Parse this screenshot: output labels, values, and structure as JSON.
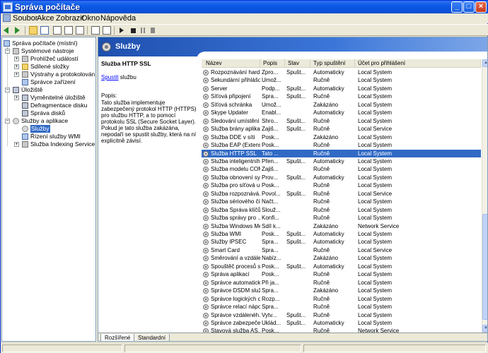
{
  "window": {
    "title": "Správa počítače"
  },
  "menu": [
    {
      "label": "Soubor"
    },
    {
      "label": "Akce"
    },
    {
      "label": "Zobrazit"
    },
    {
      "label": "Okno"
    },
    {
      "label": "Nápověda"
    }
  ],
  "tree": {
    "root": "Správa počítače (místní)",
    "items": [
      {
        "label": "Systémové nástroje"
      },
      {
        "label": "Prohlížeč událostí"
      },
      {
        "label": "Sdílené složky"
      },
      {
        "label": "Výstrahy a protokolování výk"
      },
      {
        "label": "Správce zařízení"
      },
      {
        "label": "Úložiště"
      },
      {
        "label": "Vyměnitelné úložiště"
      },
      {
        "label": "Defragmentace disku"
      },
      {
        "label": "Správa disků"
      },
      {
        "label": "Služby a aplikace"
      },
      {
        "label": "Služby"
      },
      {
        "label": "Řízení služby WMI"
      },
      {
        "label": "Služba Indexing Service"
      }
    ]
  },
  "panel": {
    "title": "Služby"
  },
  "description": {
    "service_name": "Služba HTTP SSL",
    "start_link": "Spustit",
    "start_suffix": " službu",
    "desc_label": "Popis:",
    "desc_text": "Tato služba implementuje zabezpečený protokol HTTP (HTTPS) pro službu HTTP, a to pomocí protokolu SSL (Secure Socket Layer). Pokud je tato služba zakázána, nepodaří se spustit služby, která na ní explicitně závisí."
  },
  "columns": [
    "Název",
    "Popis",
    "Stav",
    "Typ spuštění",
    "Účet pro přihlášení"
  ],
  "rows": [
    [
      "Rozpoznávání hard...",
      "Zpro...",
      "Spušt...",
      "Automaticky",
      "Local System"
    ],
    [
      "Sekundární přihlášo...",
      "Umož...",
      "",
      "Ručně",
      "Local System"
    ],
    [
      "Server",
      "Podp...",
      "Spušt...",
      "Automaticky",
      "Local System"
    ],
    [
      "Síťová připojení",
      "Spra...",
      "Spušt...",
      "Ručně",
      "Local System"
    ],
    [
      "Síťová schránka",
      "Umož...",
      "",
      "Zakázáno",
      "Local System"
    ],
    [
      "Skype Updater",
      "Enabl...",
      "",
      "Automaticky",
      "Local System"
    ],
    [
      "Sledování umístění ...",
      "Shro...",
      "Spušt...",
      "Ručně",
      "Local System"
    ],
    [
      "Služba brány aplika...",
      "Zajiš...",
      "Spušt...",
      "Ručně",
      "Local Service"
    ],
    [
      "Služba DDE v síti",
      "Posk...",
      "",
      "Zakázáno",
      "Local System"
    ],
    [
      "Služba EAP (Extens...",
      "Posk...",
      "",
      "Ručně",
      "Local System"
    ],
    [
      "Služba HTTP SSL",
      "Tato ...",
      "",
      "Ručně",
      "Local System"
    ],
    [
      "Služba inteligentníh...",
      "Přen...",
      "Spušt...",
      "Automaticky",
      "Local System"
    ],
    [
      "Služba modelu COM...",
      "Zajiš...",
      "",
      "Ručně",
      "Local System"
    ],
    [
      "Služba obnovení sy...",
      "Prov...",
      "Spušt...",
      "Automaticky",
      "Local System"
    ],
    [
      "Služba pro síťová u...",
      "Posk...",
      "",
      "Ručně",
      "Local System"
    ],
    [
      "Služba rozpoznává...",
      "Povol...",
      "Spušt...",
      "Ručně",
      "Local Service"
    ],
    [
      "Služba sériového čí...",
      "Načt...",
      "",
      "Ručně",
      "Local System"
    ],
    [
      "Služba Správa klíčů ...",
      "Slouž...",
      "",
      "Ručně",
      "Local System"
    ],
    [
      "Služba správy pro ...",
      "Konfi...",
      "",
      "Ručně",
      "Local System"
    ],
    [
      "Služba Windows Me...",
      "Sdíl k...",
      "",
      "Zakázáno",
      "Network Service"
    ],
    [
      "Služba WMI",
      "Posk...",
      "Spušt...",
      "Automaticky",
      "Local System"
    ],
    [
      "Služby IPSEC",
      "Spra...",
      "Spušt...",
      "Automaticky",
      "Local System"
    ],
    [
      "Smart Card",
      "Spra...",
      "",
      "Ručně",
      "Local Service"
    ],
    [
      "Směrování a vzdále...",
      "Nabíz...",
      "",
      "Zakázáno",
      "Local System"
    ],
    [
      "Spouštěč procesů s...",
      "Posk...",
      "Spušt...",
      "Automaticky",
      "Local System"
    ],
    [
      "Správa aplikací",
      "Posk...",
      "",
      "Ručně",
      "Local System"
    ],
    [
      "Správce automatick...",
      "Při ja...",
      "",
      "Ručně",
      "Local System"
    ],
    [
      "Správce DSDM služ...",
      "Spra...",
      "",
      "Zakázáno",
      "Local System"
    ],
    [
      "Správce logických d...",
      "Rozp...",
      "",
      "Ručně",
      "Local System"
    ],
    [
      "Správce relací nápo...",
      "Spra...",
      "",
      "Ručně",
      "Local System"
    ],
    [
      "Správce vzdálenéh...",
      "Vytv...",
      "Spušt...",
      "Ručně",
      "Local System"
    ],
    [
      "Správce zabezpeče...",
      "Uklád...",
      "Spušt...",
      "Automaticky",
      "Local System"
    ],
    [
      "Stavová služba AS...",
      "Posk...",
      "",
      "Ručně",
      "Network Service"
    ]
  ],
  "selected_row_index": 10,
  "tabs": [
    {
      "label": "Rozšířené"
    },
    {
      "label": "Standardní"
    }
  ]
}
